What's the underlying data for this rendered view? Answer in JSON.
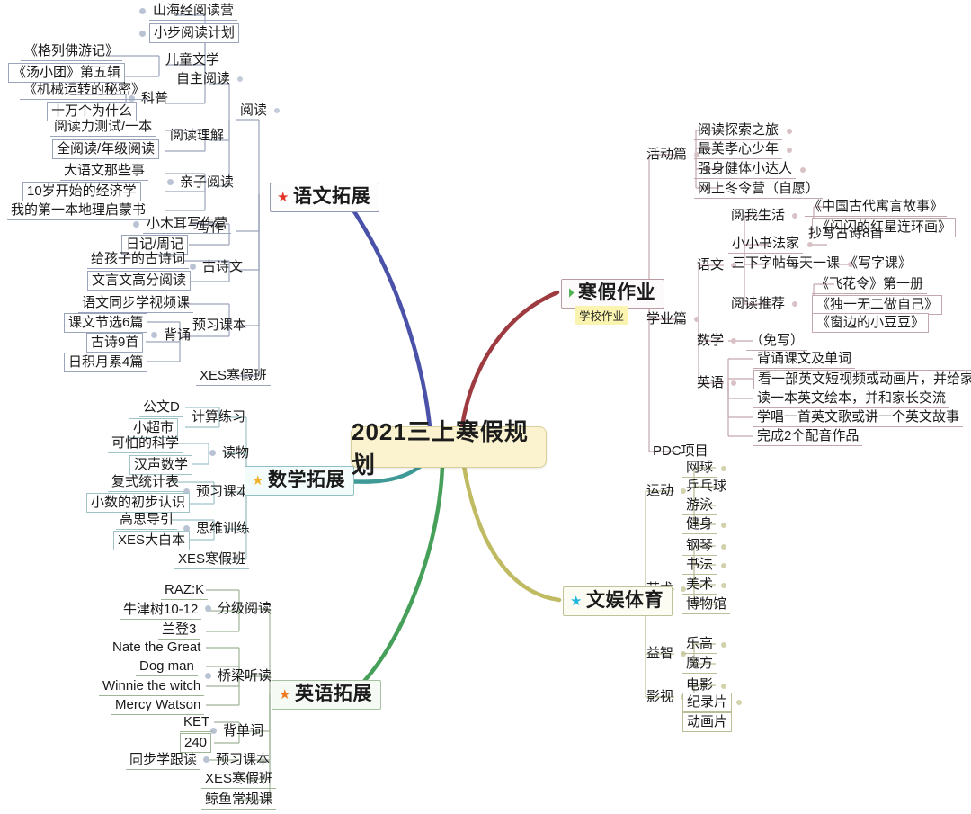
{
  "center": {
    "title": "2021三上寒假规划"
  },
  "colors": {
    "center_fill": "#fbf3cf",
    "center_border": "#d9cf9a",
    "branch_lang": "#4a51a8",
    "branch_homework": "#9e3b41",
    "branch_math": "#3f9a97",
    "branch_english": "#46a05a",
    "branch_fun": "#c0bb62",
    "note_highlight": "#fbf4b0",
    "star_red": "#e3342a",
    "star_gold": "#f0b32b",
    "star_orange": "#ef7b1e",
    "star_cyan": "#1fb6e0",
    "play_green": "#4caf50"
  },
  "branches": [
    {
      "id": "lang",
      "label": "语文拓展",
      "icon": "star-red-icon",
      "children": [
        {
          "label": "阅读",
          "children": [
            {
              "label": "自主阅读",
              "children": [
                {
                  "label": "山海经阅读营",
                  "boxed": false
                },
                {
                  "label": "小步阅读计划",
                  "boxed": true
                },
                {
                  "label": "儿童文学",
                  "children": [
                    {
                      "label": "《格列佛游记》",
                      "boxed": false
                    },
                    {
                      "label": "《汤小团》第五辑",
                      "boxed": true
                    }
                  ]
                },
                {
                  "label": "科普",
                  "children": [
                    {
                      "label": "《机械运转的秘密》",
                      "boxed": false
                    },
                    {
                      "label": "十万个为什么",
                      "boxed": true
                    }
                  ]
                }
              ]
            },
            {
              "label": "阅读理解",
              "children": [
                {
                  "label": "阅读力测试/一本",
                  "boxed": false
                },
                {
                  "label": "全阅读/年级阅读",
                  "boxed": true
                }
              ]
            },
            {
              "label": "亲子阅读",
              "children": [
                {
                  "label": "大语文那些事",
                  "boxed": false
                },
                {
                  "label": "10岁开始的经济学",
                  "boxed": true
                },
                {
                  "label": "我的第一本地理启蒙书",
                  "boxed": false
                }
              ]
            }
          ]
        },
        {
          "label": "写作",
          "children": [
            {
              "label": "小木耳写作营",
              "boxed": false
            },
            {
              "label": "日记/周记",
              "boxed": true
            }
          ]
        },
        {
          "label": "古诗文",
          "children": [
            {
              "label": "给孩子的古诗词",
              "boxed": false
            },
            {
              "label": "文言文高分阅读",
              "boxed": true
            }
          ]
        },
        {
          "label": "预习课本",
          "children": [
            {
              "label": "语文同步学视频课",
              "boxed": false
            },
            {
              "label": "背诵",
              "children": [
                {
                  "label": "课文节选6篇",
                  "boxed": true
                },
                {
                  "label": "古诗9首",
                  "boxed": true
                },
                {
                  "label": "日积月累4篇",
                  "boxed": true
                }
              ]
            }
          ]
        },
        {
          "label": "XES寒假班",
          "boxed": false
        }
      ]
    },
    {
      "id": "math",
      "label": "数学拓展",
      "icon": "star-gold-icon",
      "children": [
        {
          "label": "计算练习",
          "children": [
            {
              "label": "公文D",
              "boxed": false
            },
            {
              "label": "小超市",
              "boxed": true
            }
          ]
        },
        {
          "label": "读物",
          "children": [
            {
              "label": "可怕的科学",
              "boxed": false
            },
            {
              "label": "汉声数学",
              "boxed": true
            }
          ]
        },
        {
          "label": "预习课本",
          "children": [
            {
              "label": "复式统计表",
              "boxed": false
            },
            {
              "label": "小数的初步认识",
              "boxed": true
            }
          ]
        },
        {
          "label": "思维训练",
          "children": [
            {
              "label": "高思导引",
              "boxed": false
            },
            {
              "label": "XES大白本",
              "boxed": true
            }
          ]
        },
        {
          "label": "XES寒假班",
          "boxed": false
        }
      ]
    },
    {
      "id": "english",
      "label": "英语拓展",
      "icon": "star-orange-icon",
      "children": [
        {
          "label": "分级阅读",
          "children": [
            {
              "label": "RAZ:K",
              "boxed": false
            },
            {
              "label": "牛津树10-12",
              "boxed": false
            },
            {
              "label": "兰登3",
              "boxed": false
            }
          ]
        },
        {
          "label": "桥梁听读",
          "children": [
            {
              "label": "Nate the Great",
              "boxed": false
            },
            {
              "label": "Dog man",
              "boxed": false
            },
            {
              "label": "Winnie the witch",
              "boxed": false
            },
            {
              "label": "Mercy Watson",
              "boxed": false
            }
          ]
        },
        {
          "label": "背单词",
          "children": [
            {
              "label": "KET",
              "boxed": false
            },
            {
              "label": "240",
              "boxed": true
            }
          ]
        },
        {
          "label": "预习课本",
          "children": [
            {
              "label": "同步学跟读",
              "boxed": false
            }
          ]
        },
        {
          "label": "XES寒假班",
          "boxed": false
        },
        {
          "label": "鲸鱼常规课",
          "boxed": false
        }
      ]
    },
    {
      "id": "homework",
      "label": "寒假作业",
      "icon": "play-circle-icon",
      "note": "学校作业",
      "children": [
        {
          "label": "活动篇",
          "children": [
            {
              "label": "阅读探索之旅",
              "boxed": false
            },
            {
              "label": "最美孝心少年",
              "boxed": false
            },
            {
              "label": "强身健体小达人",
              "boxed": false
            },
            {
              "label": "网上冬令营（自愿）",
              "boxed": false
            }
          ]
        },
        {
          "label": "学业篇",
          "children": [
            {
              "label": "语文",
              "children": [
                {
                  "label": "阅我生活",
                  "children": [
                    {
                      "label": "《中国古代寓言故事》",
                      "boxed": false
                    },
                    {
                      "label": "《闪闪的红星连环画》",
                      "boxed": true
                    }
                  ]
                },
                {
                  "label": "小小书法家",
                  "children": [
                    {
                      "label": "抄写古诗8首",
                      "boxed": false
                    }
                  ]
                },
                {
                  "label": "三下字帖每天一课",
                  "children": [
                    {
                      "label": "《写字课》",
                      "boxed": false
                    }
                  ]
                },
                {
                  "label": "阅读推荐",
                  "children": [
                    {
                      "label": "《飞花令》第一册",
                      "boxed": false
                    },
                    {
                      "label": "《独一无二做自己》",
                      "boxed": true
                    },
                    {
                      "label": "《窗边的小豆豆》",
                      "boxed": true
                    }
                  ]
                }
              ]
            },
            {
              "label": "数学",
              "children": [
                {
                  "label": "（免写）",
                  "boxed": false
                }
              ]
            },
            {
              "label": "英语",
              "children": [
                {
                  "label": "背诵课文及单词",
                  "boxed": false
                },
                {
                  "label": "看一部英文短视频或动画片，并给家长讲讲",
                  "boxed": true
                },
                {
                  "label": "读一本英文绘本，并和家长交流",
                  "boxed": false
                },
                {
                  "label": "学唱一首英文歌或讲一个英文故事",
                  "boxed": false
                },
                {
                  "label": "完成2个配音作品",
                  "boxed": false
                }
              ]
            }
          ]
        },
        {
          "label": "PDC项目",
          "boxed": false
        }
      ]
    },
    {
      "id": "fun",
      "label": "文娱体育",
      "icon": "star-cyan-icon",
      "children": [
        {
          "label": "运动",
          "children": [
            {
              "label": "网球",
              "boxed": false
            },
            {
              "label": "乒乓球",
              "boxed": false
            },
            {
              "label": "游泳",
              "boxed": false
            },
            {
              "label": "健身",
              "boxed": false
            }
          ]
        },
        {
          "label": "艺术",
          "children": [
            {
              "label": "钢琴",
              "boxed": false
            },
            {
              "label": "书法",
              "boxed": false
            },
            {
              "label": "美术",
              "boxed": false
            },
            {
              "label": "博物馆",
              "boxed": false
            }
          ]
        },
        {
          "label": "益智",
          "children": [
            {
              "label": "乐高",
              "boxed": false
            },
            {
              "label": "魔方",
              "boxed": false
            }
          ]
        },
        {
          "label": "影视",
          "children": [
            {
              "label": "电影",
              "boxed": false
            },
            {
              "label": "纪录片",
              "boxed": false
            },
            {
              "label": "动画片",
              "boxed": false
            }
          ]
        }
      ]
    }
  ]
}
